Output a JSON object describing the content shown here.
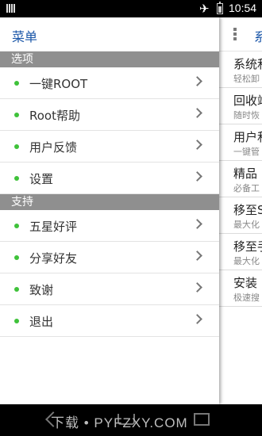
{
  "status_bar": {
    "time": "10:54",
    "icons": [
      "notification-icon",
      "airplane-icon",
      "battery-icon"
    ]
  },
  "drawer": {
    "title": "菜单",
    "sections": [
      {
        "header": "选项",
        "items": [
          {
            "label": "一键ROOT"
          },
          {
            "label": "Root帮助"
          },
          {
            "label": "用户反馈"
          },
          {
            "label": "设置"
          }
        ]
      },
      {
        "header": "支持",
        "items": [
          {
            "label": "五星好评"
          },
          {
            "label": "分享好友"
          },
          {
            "label": "致谢"
          },
          {
            "label": "退出"
          }
        ]
      }
    ]
  },
  "background_panel": {
    "title": "系",
    "items": [
      {
        "title": "系统和",
        "subtitle": "轻松卸"
      },
      {
        "title": "回收竡",
        "subtitle": "随时恢"
      },
      {
        "title": "用户和",
        "subtitle": "一键管"
      },
      {
        "title": "精品",
        "subtitle": "必备工"
      },
      {
        "title": "移至S",
        "subtitle": "最大化"
      },
      {
        "title": "移至手",
        "subtitle": "最大化"
      },
      {
        "title": "安装",
        "subtitle": "极速搜"
      }
    ]
  },
  "nav_bar": {
    "watermark": "下载 • PYFZXY.COM"
  },
  "colors": {
    "accent": "#1a56a8",
    "dot": "#3fc23a",
    "section_bg": "#8f8f8f"
  }
}
